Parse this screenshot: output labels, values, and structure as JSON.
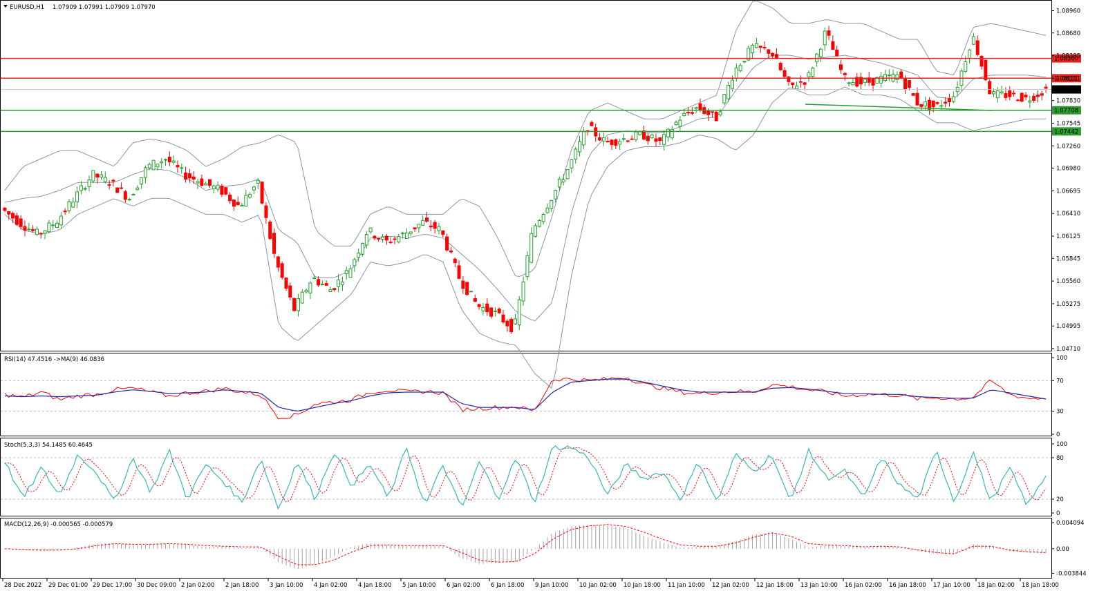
{
  "header": {
    "symbol": "EURUSD,H1",
    "ohlc": "1.07909 1.07991 1.07909 1.07970"
  },
  "panels": {
    "rsi": "RSI(14) 47.4516  ->MA(9) 46.0836",
    "stoch": "Stoch(5,3,3) 54.1485 60.4645",
    "macd": "MACD(12,26,9) -0.000565 -0.000579"
  },
  "colors": {
    "bull": "#22a02a",
    "bear": "#ff0000",
    "bands": "#8a96a8",
    "resistance": "#e8221b",
    "support": "#2d9b2d",
    "rsi_line": "#ff0000",
    "rsi_ma": "#1f2aa8",
    "stoch_main": "#35b8b8",
    "stoch_signal": "#ff0000",
    "macd_hist": "#a0a0a0",
    "macd_signal": "#ff0000"
  },
  "chart_data": [
    {
      "type": "candlestick",
      "symbol": "EURUSD",
      "timeframe": "H1",
      "ylim": [
        1.0471,
        1.0906
      ],
      "y_ticks": [
        "1.08960",
        "1.08680",
        "1.08395",
        "1.08111",
        "1.07830",
        "1.07545",
        "1.07260",
        "1.06980",
        "1.06695",
        "1.06410",
        "1.06125",
        "1.05845",
        "1.05560",
        "1.05275",
        "1.04995",
        "1.04710"
      ],
      "x_ticks": [
        "28 Dec 2022",
        "29 Dec 01:00",
        "29 Dec 17:00",
        "30 Dec 09:00",
        "2 Jan 02:00",
        "2 Jan 18:00",
        "3 Jan 10:00",
        "4 Jan 02:00",
        "4 Jan 18:00",
        "5 Jan 10:00",
        "6 Jan 02:00",
        "6 Jan 18:00",
        "9 Jan 10:00",
        "10 Jan 02:00",
        "10 Jan 18:00",
        "11 Jan 10:00",
        "12 Jan 02:00",
        "12 Jan 18:00",
        "13 Jan 10:00",
        "16 Jan 02:00",
        "16 Jan 18:00",
        "17 Jan 10:00",
        "18 Jan 02:00",
        "18 Jan 18:00"
      ],
      "anchors": [
        1.0648,
        1.063,
        1.0615,
        1.063,
        1.066,
        1.069,
        1.068,
        1.066,
        1.07,
        1.071,
        1.069,
        1.068,
        1.067,
        1.065,
        1.068,
        1.058,
        1.052,
        1.056,
        1.0545,
        1.057,
        1.062,
        1.0605,
        1.0615,
        1.063,
        1.062,
        1.056,
        1.0525,
        1.0515,
        1.0495,
        1.062,
        1.066,
        1.07,
        1.075,
        1.073,
        1.0735,
        1.074,
        1.073,
        1.076,
        1.0775,
        1.076,
        1.082,
        1.085,
        1.0845,
        1.08,
        1.081,
        1.087,
        1.081,
        1.0805,
        1.081,
        1.0815,
        1.078,
        1.0775,
        1.079,
        1.0865,
        1.079,
        1.079,
        1.0785,
        1.0797
      ],
      "bands_upper": [
        1.067,
        1.07,
        1.071,
        1.072,
        1.072,
        1.071,
        1.07,
        1.073,
        1.0735,
        1.073,
        1.072,
        1.07,
        1.071,
        1.0725,
        1.073,
        1.074,
        1.073,
        1.062,
        1.06,
        1.06,
        1.064,
        1.065,
        1.064,
        1.064,
        1.064,
        1.066,
        1.065,
        1.061,
        1.056,
        1.057,
        1.064,
        1.072,
        1.077,
        1.078,
        1.077,
        1.076,
        1.076,
        1.077,
        1.078,
        1.079,
        1.087,
        1.091,
        1.09,
        1.088,
        1.088,
        1.0885,
        1.088,
        1.088,
        1.087,
        1.086,
        1.086,
        1.082,
        1.0815,
        1.0875,
        1.088,
        1.0875,
        1.087,
        1.0865
      ],
      "bands_lower": [
        1.064,
        1.062,
        1.0615,
        1.062,
        1.064,
        1.065,
        1.066,
        1.065,
        1.066,
        1.066,
        1.065,
        1.064,
        1.064,
        1.063,
        1.064,
        1.05,
        1.048,
        1.05,
        1.052,
        1.054,
        1.058,
        1.0575,
        1.058,
        1.059,
        1.058,
        1.052,
        1.049,
        1.048,
        1.0475,
        1.044,
        1.042,
        1.056,
        1.066,
        1.07,
        1.072,
        1.0725,
        1.0725,
        1.073,
        1.074,
        1.0735,
        1.072,
        1.074,
        1.078,
        1.08,
        1.079,
        1.079,
        1.08,
        1.079,
        1.079,
        1.0785,
        1.077,
        1.0755,
        1.0755,
        1.0745,
        1.075,
        1.0755,
        1.076,
        1.076
      ],
      "levels": [
        {
          "label": "1.08360",
          "value": 1.0836,
          "kind": "resistance"
        },
        {
          "label": "1.08111",
          "value": 1.08111,
          "kind": "resistance"
        },
        {
          "label": "1.07970",
          "value": 1.0797,
          "kind": "current"
        },
        {
          "label": "1.07708",
          "value": 1.07708,
          "kind": "support"
        },
        {
          "label": "1.07442",
          "value": 1.07442,
          "kind": "support"
        }
      ]
    },
    {
      "type": "line",
      "name": "RSI(14)",
      "ylim": [
        0,
        100
      ],
      "y_ticks": [
        "100",
        "70",
        "30",
        "0"
      ],
      "levels": [
        70,
        30
      ],
      "anchors": [
        52,
        48,
        55,
        45,
        50,
        52,
        58,
        60,
        55,
        50,
        54,
        56,
        60,
        55,
        52,
        22,
        25,
        40,
        42,
        45,
        55,
        58,
        55,
        56,
        54,
        32,
        34,
        35,
        36,
        30,
        72,
        72,
        70,
        72,
        75,
        65,
        60,
        55,
        53,
        55,
        56,
        55,
        65,
        62,
        58,
        55,
        50,
        52,
        52,
        51,
        46,
        48,
        46,
        48,
        70,
        52,
        47,
        47
      ],
      "ma_anchors": [
        50,
        49,
        50,
        49,
        50,
        51,
        55,
        58,
        56,
        53,
        54,
        55,
        58,
        56,
        54,
        35,
        30,
        35,
        40,
        44,
        50,
        54,
        55,
        55,
        55,
        40,
        35,
        35,
        35,
        32,
        55,
        68,
        70,
        72,
        72,
        68,
        63,
        58,
        55,
        55,
        55,
        55,
        60,
        61,
        59,
        56,
        53,
        53,
        52,
        52,
        49,
        48,
        47,
        47,
        58,
        54,
        50,
        46
      ]
    },
    {
      "type": "line",
      "name": "Stoch(5,3,3)",
      "ylim": [
        0,
        100
      ],
      "y_ticks": [
        "100",
        "80",
        "20",
        "0"
      ],
      "levels": [
        80,
        20
      ],
      "anchors": [
        75,
        20,
        65,
        25,
        85,
        60,
        15,
        80,
        30,
        90,
        20,
        70,
        45,
        15,
        80,
        5,
        75,
        20,
        90,
        40,
        70,
        20,
        95,
        10,
        70,
        5,
        75,
        20,
        80,
        15,
        95,
        95,
        80,
        25,
        70,
        50,
        60,
        20,
        75,
        15,
        85,
        60,
        85,
        15,
        90,
        50,
        60,
        20,
        80,
        40,
        20,
        90,
        15,
        90,
        15,
        65,
        10,
        55
      ],
      "signal_offset": 1
    },
    {
      "type": "bar",
      "name": "MACD(12,26,9)",
      "ylim": [
        -0.0038,
        0.0041
      ],
      "y_ticks": [
        "0.004094",
        "0.00",
        "-0.003844"
      ],
      "hist_anchors": [
        0,
        -0.0002,
        -0.0004,
        -0.0003,
        0.0002,
        0.0008,
        0.0009,
        0.0005,
        0.0007,
        0.0008,
        0.0006,
        0.0003,
        0.0004,
        0.0001,
        0.0003,
        -0.0022,
        -0.0032,
        -0.0025,
        -0.0012,
        0.0003,
        0.0009,
        0.0006,
        0.0004,
        0.0006,
        0.0004,
        -0.0015,
        -0.0024,
        -0.0022,
        -0.002,
        0.0,
        0.0025,
        0.0035,
        0.0038,
        0.0036,
        0.0033,
        0.002,
        0.001,
        0.0002,
        0.0003,
        0.0004,
        0.0012,
        0.0022,
        0.0026,
        0.0016,
        0.0002,
        0.0006,
        0.0004,
        0.0002,
        0.0004,
        0.0003,
        -0.0004,
        -0.0008,
        -0.0009,
        0.0007,
        0.0005,
        -0.0004,
        -0.0006,
        -0.0006
      ],
      "signal_anchors": [
        0,
        -0.0001,
        -0.0002,
        -0.0002,
        0,
        0.0005,
        0.0008,
        0.0007,
        0.0007,
        0.0008,
        0.0007,
        0.0005,
        0.0004,
        0.0003,
        0.0003,
        -0.0012,
        -0.0025,
        -0.0025,
        -0.0018,
        -0.0005,
        0.0005,
        0.0006,
        0.0005,
        0.0005,
        0.0005,
        -0.0006,
        -0.0018,
        -0.0021,
        -0.002,
        -0.0008,
        0.0015,
        0.003,
        0.0036,
        0.0038,
        0.0035,
        0.0026,
        0.0015,
        0.0006,
        0.0004,
        0.0004,
        0.0009,
        0.0018,
        0.0025,
        0.002,
        0.0008,
        0.0006,
        0.0005,
        0.0003,
        0.0004,
        0.0003,
        -0.0002,
        -0.0006,
        -0.0008,
        0.0004,
        0.0004,
        -0.0002,
        -0.0005,
        -0.0006
      ]
    }
  ]
}
